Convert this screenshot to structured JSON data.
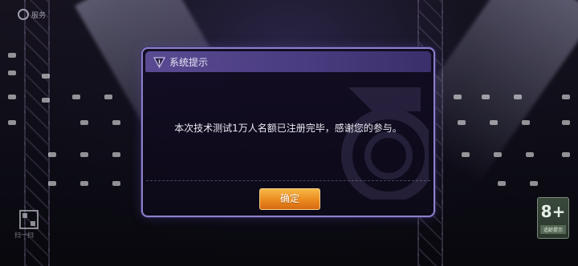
{
  "background": {
    "corner_label": "服务",
    "qr_label": "扫一扫",
    "age_rating": {
      "number": "8+",
      "label": "适龄提示"
    }
  },
  "dialog": {
    "title": "系统提示",
    "title_icon": "warning-icon",
    "message": "本次技术测试1万人名额已注册完毕，感谢您的参与。",
    "confirm_label": "确定"
  },
  "colors": {
    "dialog_border": "#8c80c8",
    "titlebar": "#4a3c80",
    "button": "#ea8a1e"
  }
}
